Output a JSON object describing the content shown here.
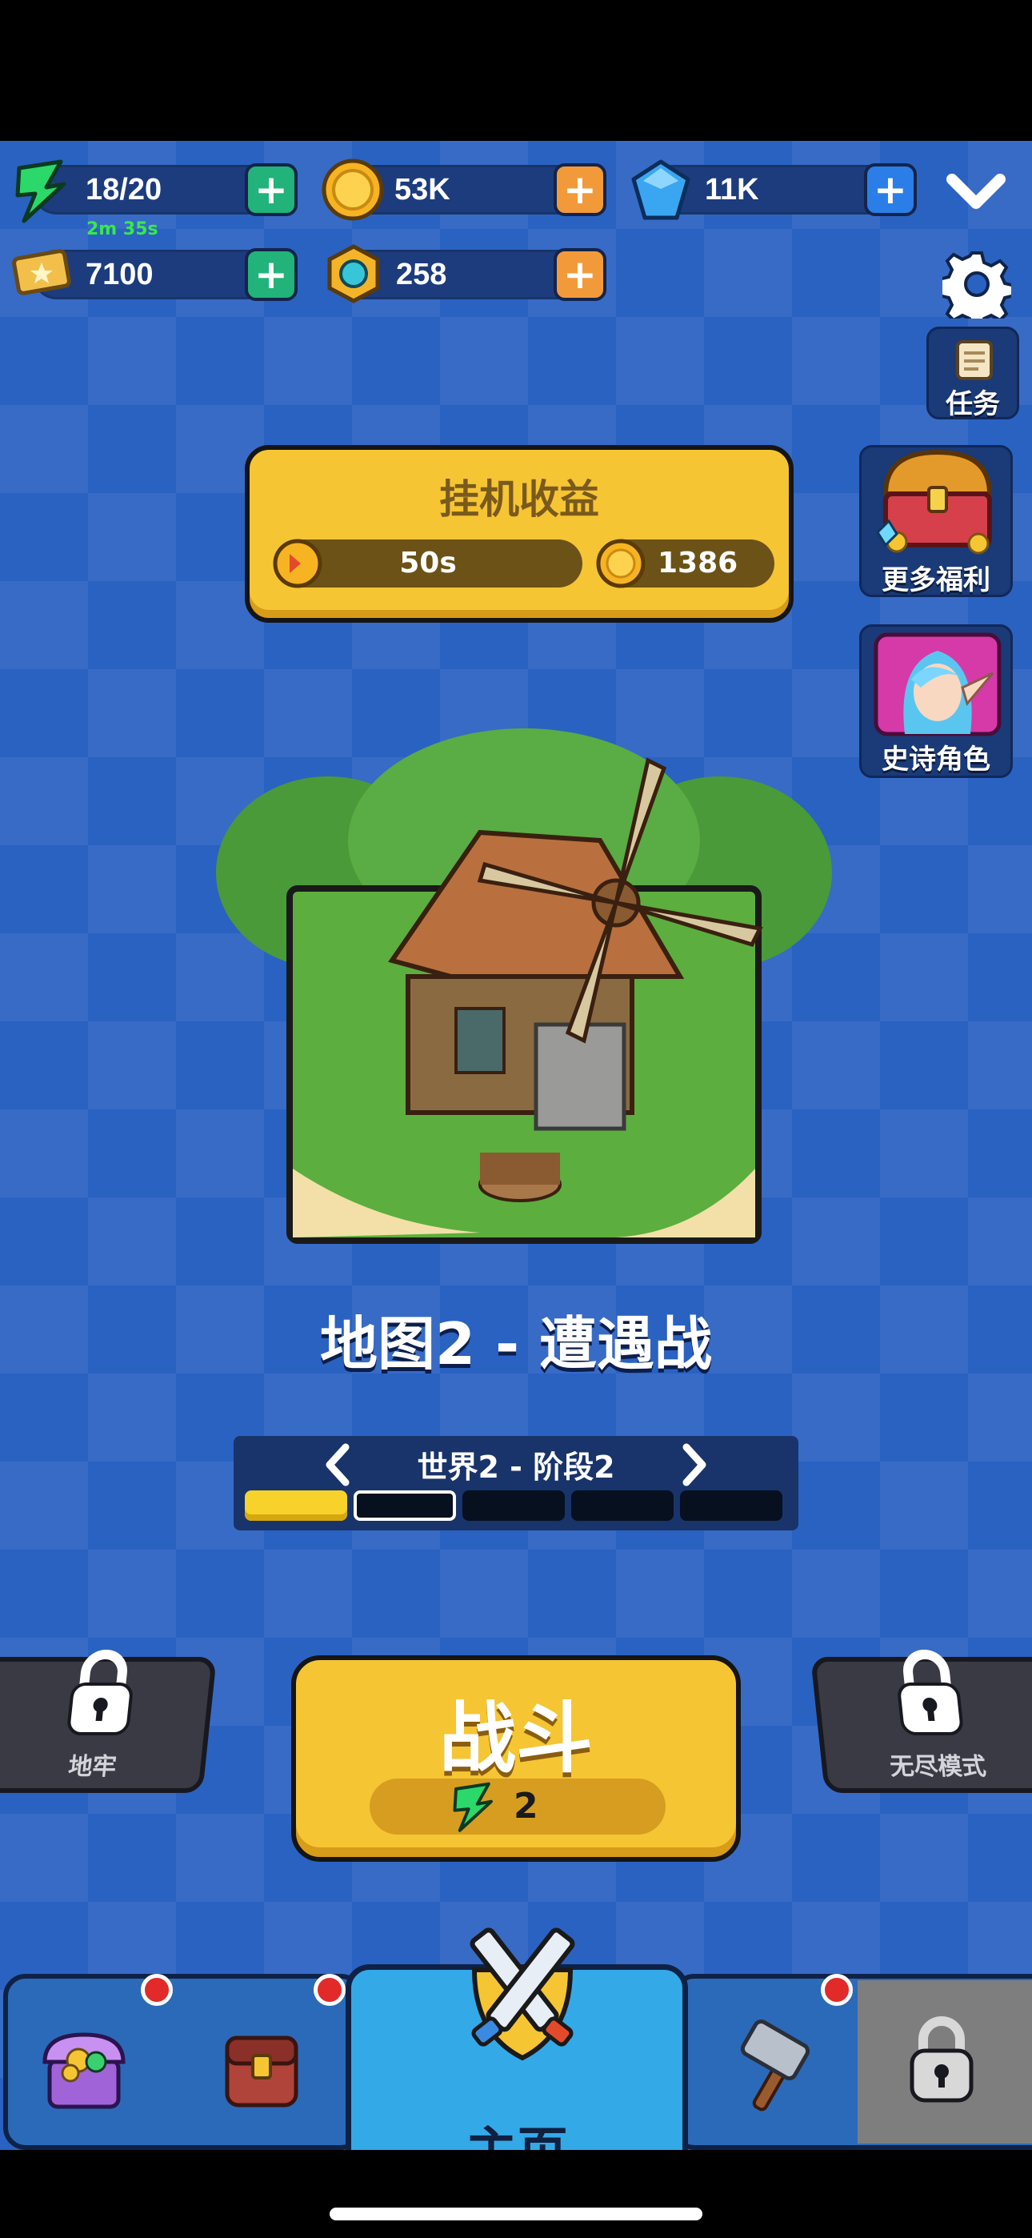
{
  "resources": {
    "energy": {
      "value": "18/20",
      "timer": "2m 35s"
    },
    "coins": {
      "value": "53K"
    },
    "gems": {
      "value": "11K"
    },
    "tickets": {
      "value": "7100"
    },
    "tokens": {
      "value": "258"
    }
  },
  "side_buttons": {
    "tasks": "任务",
    "more_rewards": "更多福利",
    "epic_heroes": "史诗角色"
  },
  "idle_rewards": {
    "title": "挂机收益",
    "time": "50s",
    "coins": "1386"
  },
  "map": {
    "title": "地图2 - 遭遇战",
    "stage_label": "世界2 - 阶段2",
    "stage_total": 5,
    "stage_completed": 1,
    "stage_current": 2
  },
  "battle": {
    "label": "战斗",
    "cost": "2"
  },
  "modes": {
    "dungeon": "地牢",
    "endless": "无尽模式"
  },
  "nav": {
    "home": "主页"
  },
  "colors": {
    "background": "#2a62c2",
    "accent_yellow": "#f6c533",
    "plus_green": "#22b37a",
    "plus_orange": "#f29a3a",
    "plus_blue": "#2b7ee8",
    "badge_red": "#e22a2a"
  },
  "icons": [
    "energy-icon",
    "coin-icon",
    "gem-icon",
    "ticket-icon",
    "token-icon",
    "chevron-down-icon",
    "gear-icon",
    "scroll-icon",
    "treasure-chest-icon",
    "elf-hero-icon",
    "lock-icon",
    "crossed-swords-icon",
    "hammer-icon",
    "backpack-icon",
    "gift-chest-icon"
  ]
}
